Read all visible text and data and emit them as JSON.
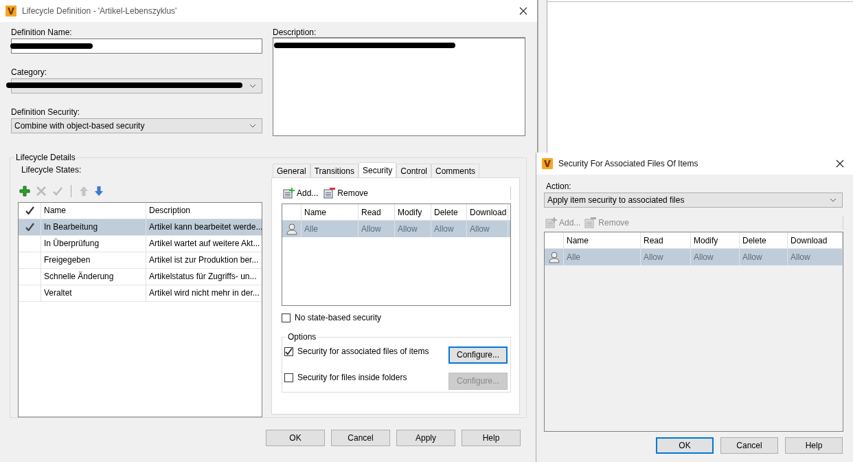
{
  "lifecycle_dialog": {
    "title": "Lifecycle Definition - 'Artikel-Lebenszyklus'",
    "definition_name": {
      "label": "Definition Name:"
    },
    "category": {
      "label": "Category:"
    },
    "definition_security": {
      "label": "Definition Security:",
      "value": "Combine with object-based security"
    },
    "description": {
      "label": "Description:"
    },
    "lifecycle_details": {
      "title": "Lifecycle Details",
      "states_label": "Lifecycle States:",
      "toolbar": [
        {
          "kind": "add",
          "disabled": false
        },
        {
          "kind": "delete",
          "disabled": true
        },
        {
          "kind": "check",
          "disabled": true
        },
        {
          "kind": "up",
          "disabled": true
        },
        {
          "kind": "down",
          "disabled": false
        }
      ],
      "columns": [
        "Name",
        "Description"
      ],
      "rows": [
        {
          "name": "In Bearbeitung",
          "description": "Artikel kann bearbeitet werde...",
          "default": true,
          "selected": true
        },
        {
          "name": "In Überprüfung",
          "description": "Artikel wartet auf weitere Akt...",
          "default": false,
          "selected": false
        },
        {
          "name": "Freigegeben",
          "description": "Artikel ist zur Produktion ber...",
          "default": false,
          "selected": false
        },
        {
          "name": "Schnelle Änderung",
          "description": "Artikelstatus für Zugriffs- un...",
          "default": false,
          "selected": false
        },
        {
          "name": "Veraltet",
          "description": "Artikel wird nicht mehr in der...",
          "default": false,
          "selected": false
        }
      ]
    },
    "tabs": [
      {
        "label": "General",
        "selected": false
      },
      {
        "label": "Transitions",
        "selected": false
      },
      {
        "label": "Security",
        "selected": true
      },
      {
        "label": "Control",
        "selected": false
      },
      {
        "label": "Comments",
        "selected": false
      }
    ],
    "security": {
      "toolbar": [
        {
          "kind": "add",
          "label": "Add...",
          "disabled": false
        },
        {
          "kind": "remove",
          "label": "Remove",
          "disabled": false
        }
      ],
      "columns": [
        "Name",
        "Read",
        "Modify",
        "Delete",
        "Download"
      ],
      "rows": [
        {
          "cells": [
            "Alle",
            "Allow",
            "Allow",
            "Allow",
            "Allow"
          ],
          "selected": true,
          "disabled": true
        }
      ],
      "no_state_based": {
        "label": "No state-based security",
        "checked": false
      },
      "options": {
        "title": "Options",
        "items": [
          {
            "label": "Security for associated files of items",
            "checked": true,
            "button": "Configure...",
            "disabled": false,
            "focused": true
          },
          {
            "label": "Security for files inside folders",
            "checked": false,
            "button": "Configure...",
            "disabled": true,
            "focused": false
          }
        ]
      }
    },
    "buttons": [
      {
        "label": "OK",
        "focused": false
      },
      {
        "label": "Cancel",
        "focused": false
      },
      {
        "label": "Apply",
        "focused": false
      },
      {
        "label": "Help",
        "focused": false
      }
    ]
  },
  "files_dialog": {
    "title": "Security For Associated Files Of Items",
    "action": {
      "label": "Action:",
      "value": "Apply item security to associated files"
    },
    "toolbar": [
      {
        "kind": "add",
        "label": "Add...",
        "disabled": true
      },
      {
        "kind": "remove",
        "label": "Remove",
        "disabled": true
      }
    ],
    "columns": [
      "Name",
      "Read",
      "Modify",
      "Delete",
      "Download"
    ],
    "rows": [
      {
        "cells": [
          "Alle",
          "Allow",
          "Allow",
          "Allow",
          "Allow"
        ],
        "selected": true,
        "disabled": true
      }
    ],
    "buttons": [
      {
        "label": "OK",
        "focused": true
      },
      {
        "label": "Cancel",
        "focused": false
      },
      {
        "label": "Help",
        "focused": false
      }
    ]
  }
}
